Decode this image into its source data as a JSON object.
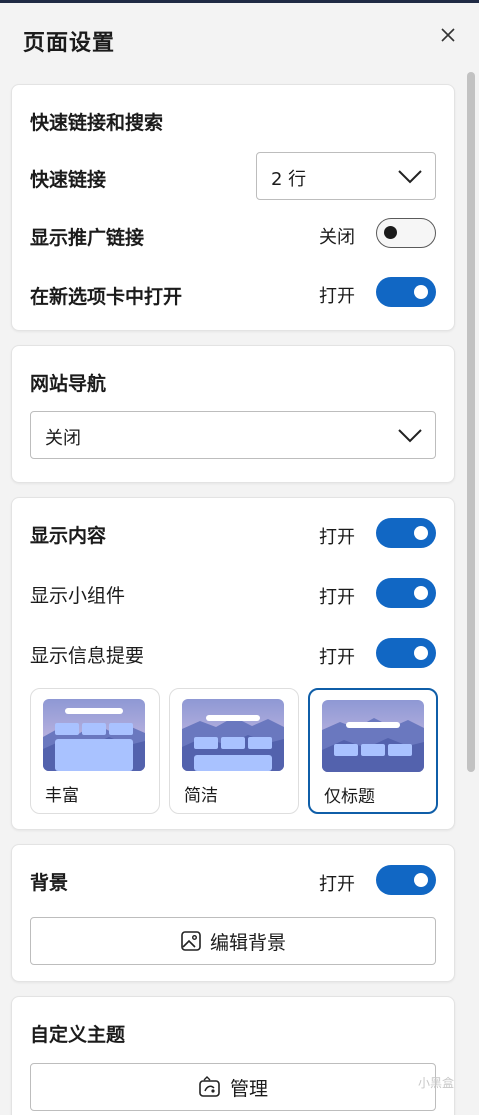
{
  "header": {
    "title": "页面设置"
  },
  "quick_links_section": {
    "heading": "快速链接和搜索",
    "quick_links": {
      "label": "快速链接",
      "value": "2 行"
    },
    "sponsored": {
      "label": "显示推广链接",
      "state": "关闭",
      "on": false
    },
    "new_tab": {
      "label": "在新选项卡中打开",
      "state": "打开",
      "on": true
    }
  },
  "site_nav": {
    "heading": "网站导航",
    "value": "关闭"
  },
  "content": {
    "heading": "显示内容",
    "state": "打开",
    "widgets": {
      "label": "显示小组件",
      "state": "打开"
    },
    "feed": {
      "label": "显示信息提要",
      "state": "打开"
    },
    "layouts": [
      "丰富",
      "简洁",
      "仅标题"
    ],
    "selected_layout": "仅标题"
  },
  "background": {
    "heading": "背景",
    "state": "打开",
    "edit_button": "编辑背景"
  },
  "theme": {
    "heading": "自定义主题",
    "manage_button": "管理"
  },
  "watermark": "小黑盒",
  "colors": {
    "accent": "#1167c4",
    "selected_border": "#0f5ea8",
    "page_bg": "#f3f3f3"
  }
}
